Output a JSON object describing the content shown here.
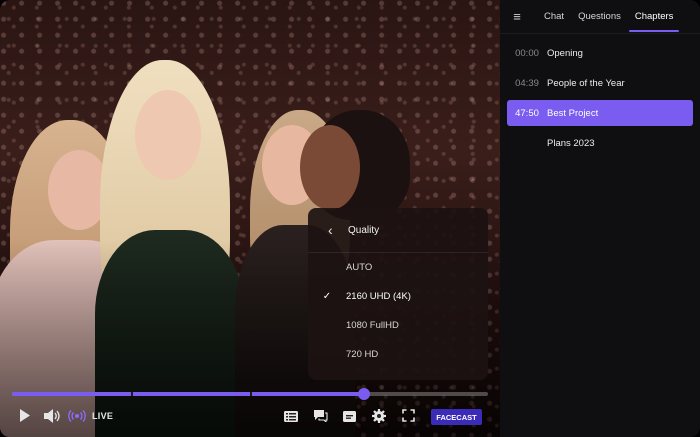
{
  "player": {
    "live_label": "LIVE",
    "brand_label": "FACECAST",
    "progress": 0.74,
    "chapter_marks": [
      0.25,
      0.5
    ],
    "quality_menu": {
      "title": "Quality",
      "options": [
        "AUTO",
        "2160 UHD (4K)",
        "1080 FullHD",
        "720 HD"
      ],
      "selected": "2160 UHD (4K)"
    },
    "accent_color": "#7b5cf0"
  },
  "panel": {
    "tabs": [
      "Chat",
      "Questions",
      "Chapters"
    ],
    "active_tab": "Chapters",
    "chapters": [
      {
        "time": "00:00",
        "title": "Opening"
      },
      {
        "time": "04:39",
        "title": "People of the Year"
      },
      {
        "time": "47:50",
        "title": "Best Project"
      },
      {
        "time": "",
        "title": "Plans 2023"
      }
    ],
    "active_chapter": 2
  },
  "icons": {
    "play": "play-icon",
    "volume": "volume-icon",
    "live": "live-broadcast-icon",
    "chapters": "chapters-list-icon",
    "chat": "chat-bubble-icon",
    "subtitles": "subtitles-icon",
    "settings": "gear-icon",
    "fullscreen": "fullscreen-icon",
    "menu": "hamburger-menu-icon",
    "back": "chevron-left-icon",
    "check": "checkmark-icon"
  }
}
